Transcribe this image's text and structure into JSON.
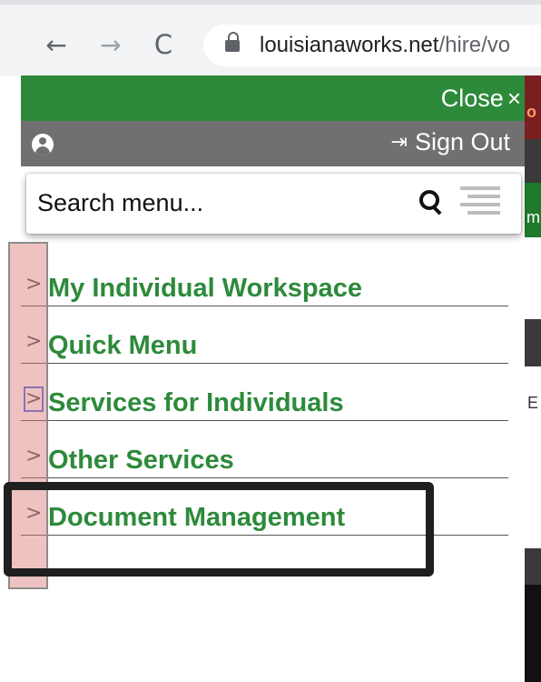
{
  "browser": {
    "back_icon": "arrow-left-icon",
    "forward_icon": "arrow-right-icon",
    "reload_icon": "reload-icon",
    "back_glyph": "←",
    "forward_glyph": "→",
    "reload_glyph": "C",
    "url_domain": "louisianaworks.net",
    "url_path": "/hire/vo"
  },
  "menu": {
    "close_label": "Close",
    "close_glyph": "×",
    "signout_label": "Sign Out",
    "signout_glyph": "⇥",
    "search_placeholder": "Search menu...",
    "items": [
      {
        "label": "My Individual Workspace",
        "chevron": ">"
      },
      {
        "label": "Quick Menu",
        "chevron": ">"
      },
      {
        "label": "Services for Individuals",
        "chevron": ">"
      },
      {
        "label": "Other Services",
        "chevron": ">"
      },
      {
        "label": "Document Management",
        "chevron": ">"
      }
    ]
  },
  "background_page": {
    "text_1": "o",
    "text_2": "m",
    "text_3": "E"
  },
  "colors": {
    "menu_green": "#2d8a3a",
    "user_bar_gray": "#707070",
    "focus_outline": "#4a6fe0",
    "highlight": "#dc7878"
  }
}
